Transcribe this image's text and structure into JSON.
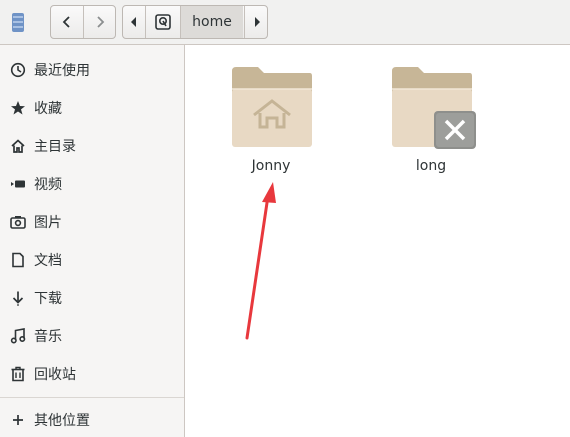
{
  "window": {
    "path_current": "home"
  },
  "colors": {
    "accent_arrow": "#e8383d",
    "folder_body": "#e7d8c3",
    "folder_tab": "#c8b799",
    "emblem_bg": "#8e8f8c"
  },
  "icons": {
    "app": "file-manager-icon",
    "back": "chevron-left-icon",
    "forward": "chevron-right-icon",
    "path_prev": "caret-left-icon",
    "path_root": "drive-icon",
    "path_next": "caret-right-icon"
  },
  "sidebar": {
    "items": [
      {
        "label": "最近使用",
        "icon": "clock-icon"
      },
      {
        "label": "收藏",
        "icon": "star-icon"
      },
      {
        "label": "主目录",
        "icon": "home-icon"
      },
      {
        "label": "视频",
        "icon": "video-icon"
      },
      {
        "label": "图片",
        "icon": "camera-icon"
      },
      {
        "label": "文档",
        "icon": "document-icon"
      },
      {
        "label": "下载",
        "icon": "download-icon"
      },
      {
        "label": "音乐",
        "icon": "music-icon"
      },
      {
        "label": "回收站",
        "icon": "trash-icon"
      },
      {
        "label": "其他位置",
        "icon": "plus-icon"
      }
    ]
  },
  "files": [
    {
      "name": "Jonny",
      "icon": "home-folder-icon"
    },
    {
      "name": "long",
      "icon": "locked-folder-icon"
    }
  ]
}
